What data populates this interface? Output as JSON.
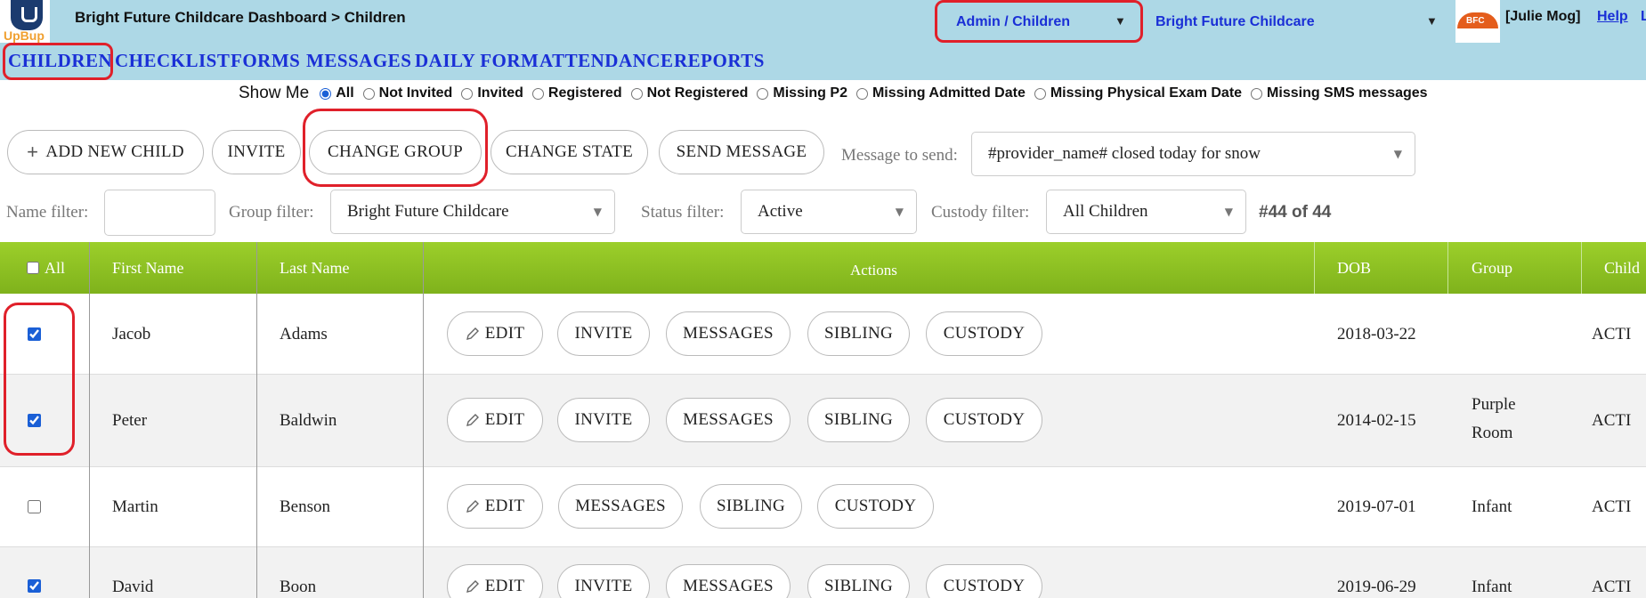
{
  "header": {
    "logo_text": "UpBup",
    "breadcrumb": "Bright Future Childcare Dashboard > Children",
    "role_select": "Admin / Children",
    "provider_select": "Bright Future Childcare",
    "avatar_text": "BFC",
    "user": "[Julie Mog]",
    "help": "Help",
    "extra_link": "L"
  },
  "nav": {
    "items": [
      "CHILDREN",
      "CHECKLIST",
      "FORMS",
      "MESSAGES",
      "DAILY FORM",
      "ATTENDANCE",
      "REPORTS"
    ]
  },
  "show_me": {
    "label": "Show Me",
    "options": [
      "All",
      "Not Invited",
      "Invited",
      "Registered",
      "Not Registered",
      "Missing P2",
      "Missing Admitted Date",
      "Missing Physical Exam Date",
      "Missing SMS messages"
    ],
    "selected": "All"
  },
  "toolbar": {
    "add_child": "ADD NEW CHILD",
    "invite": "INVITE",
    "change_group": "CHANGE GROUP",
    "change_state": "CHANGE STATE",
    "send_message": "SEND MESSAGE",
    "message_label": "Message to send:",
    "message_value": "#provider_name# closed today for snow"
  },
  "filters": {
    "name_label": "Name filter:",
    "name_value": "",
    "group_label": "Group filter:",
    "group_value": "Bright Future Childcare",
    "status_label": "Status filter:",
    "status_value": "Active",
    "custody_label": "Custody filter:",
    "custody_value": "All Children",
    "count": "#44 of 44"
  },
  "table": {
    "headers": {
      "all": "All",
      "first_name": "First Name",
      "last_name": "Last Name",
      "actions": "Actions",
      "dob": "DOB",
      "group": "Group",
      "child": "Child"
    },
    "action_labels": {
      "edit": "EDIT",
      "invite": "INVITE",
      "messages": "MESSAGES",
      "sibling": "SIBLING",
      "custody": "CUSTODY"
    },
    "rows": [
      {
        "checked": true,
        "first": "Jacob",
        "last": "Adams",
        "dob": "2018-03-22",
        "group": "",
        "status": "ACTI"
      },
      {
        "checked": true,
        "first": "Peter",
        "last": "Baldwin",
        "dob": "2014-02-15",
        "group": "Purple Room",
        "status": "ACTI"
      },
      {
        "checked": false,
        "first": "Martin",
        "last": "Benson",
        "dob": "2019-07-01",
        "group": "Infant",
        "status": "ACTI"
      },
      {
        "checked": true,
        "first": "David",
        "last": "Boon",
        "dob": "2019-06-29",
        "group": "Infant",
        "status": "ACTI"
      }
    ]
  },
  "colors": {
    "header_bg": "#add8e6",
    "table_header": "#8bc21f",
    "link_blue": "#1a2fd6",
    "highlight_red": "#e0202a"
  }
}
